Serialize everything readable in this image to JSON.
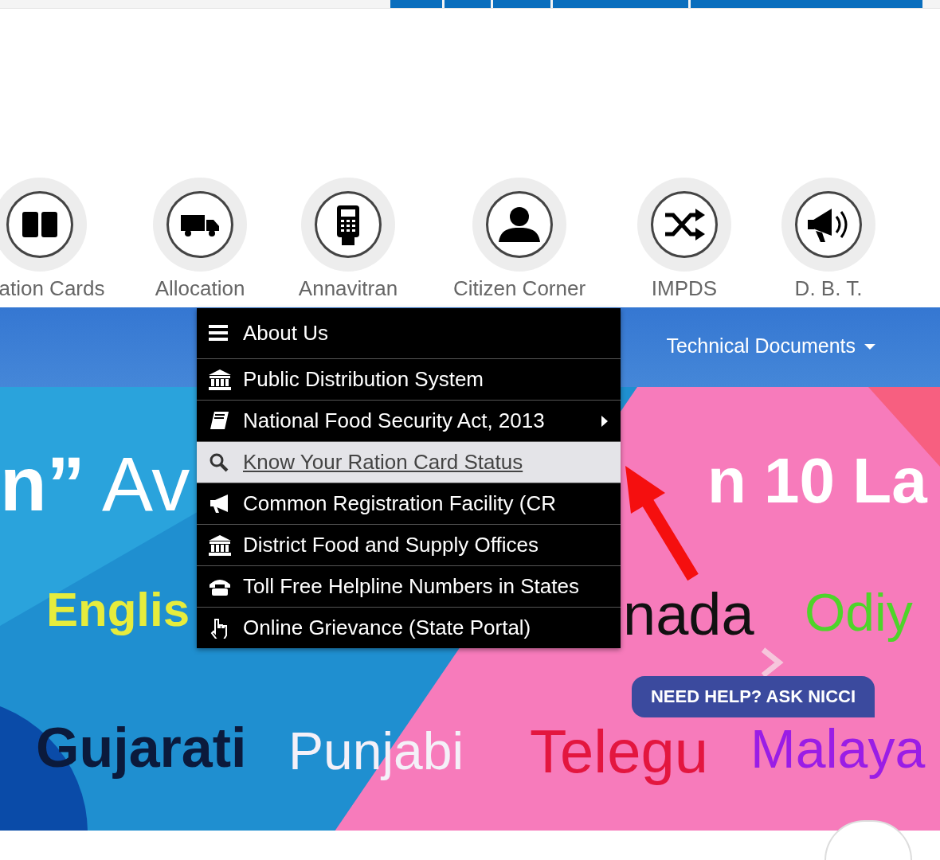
{
  "quick_links": [
    {
      "label": "ation Cards",
      "kind": "book"
    },
    {
      "label": "Allocation",
      "kind": "truck"
    },
    {
      "label": "Annavitran",
      "kind": "pos"
    },
    {
      "label": "Citizen Corner",
      "kind": "person"
    },
    {
      "label": "IMPDS",
      "kind": "shuffle"
    },
    {
      "label": "D. B. T.",
      "kind": "megaphone"
    }
  ],
  "nav": {
    "items": [
      {
        "label": "Technical Documents",
        "has_dropdown": true
      }
    ]
  },
  "menu": {
    "items": [
      {
        "label": "About Us",
        "kind": "bars",
        "submenu": false,
        "selected": false
      },
      {
        "label": "Public Distribution System",
        "kind": "bank",
        "submenu": false,
        "selected": false
      },
      {
        "label": "National Food Security Act, 2013",
        "kind": "book",
        "submenu": true,
        "selected": false
      },
      {
        "label": "Know Your Ration Card Status",
        "kind": "search",
        "submenu": false,
        "selected": true
      },
      {
        "label": "Common Registration Facility (CR",
        "kind": "bullhorn",
        "submenu": false,
        "selected": false
      },
      {
        "label": "District Food and Supply Offices",
        "kind": "bank",
        "submenu": false,
        "selected": false
      },
      {
        "label": "Toll Free Helpline Numbers in States",
        "kind": "phone",
        "submenu": false,
        "selected": false
      },
      {
        "label": "Online Grievance (State Portal)",
        "kind": "hand",
        "submenu": false,
        "selected": false
      }
    ]
  },
  "banner": {
    "texts": [
      {
        "text": "n”",
        "color": "#ffffff"
      },
      {
        "text": "Av",
        "color": "#ffffff"
      },
      {
        "text": "n 10 La",
        "color": "#ffffff"
      },
      {
        "text": "Englis",
        "color": "#e6ec3c"
      },
      {
        "text": "nada",
        "color": "#111111"
      },
      {
        "text": "Odiy",
        "color": "#4ed42a"
      },
      {
        "text": "Gujarati",
        "color": "#0b1a3c"
      },
      {
        "text": "Punjabi",
        "color": "#f4f0f8"
      },
      {
        "text": "Telegu",
        "color": "#e3163f"
      },
      {
        "text": "Malaya",
        "color": "#9a1de6"
      }
    ]
  },
  "help_button": {
    "label": "NEED HELP? ASK NICCI"
  }
}
